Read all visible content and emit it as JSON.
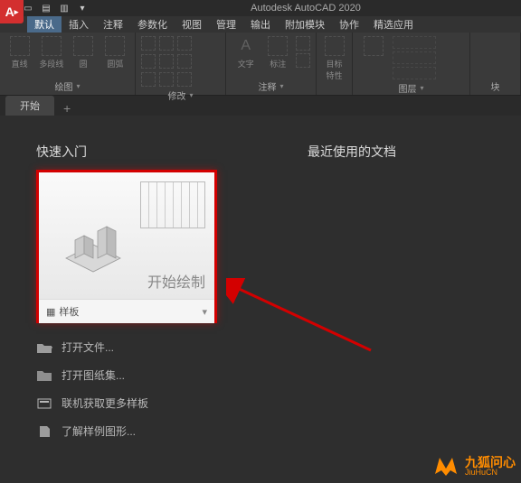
{
  "titlebar": {
    "app_title": "Autodesk AutoCAD 2020"
  },
  "logo": "A",
  "menus": {
    "items": [
      {
        "label": "默认",
        "active": true
      },
      {
        "label": "插入",
        "active": false
      },
      {
        "label": "注释",
        "active": false
      },
      {
        "label": "参数化",
        "active": false
      },
      {
        "label": "视图",
        "active": false
      },
      {
        "label": "管理",
        "active": false
      },
      {
        "label": "输出",
        "active": false
      },
      {
        "label": "附加模块",
        "active": false
      },
      {
        "label": "协作",
        "active": false
      },
      {
        "label": "精选应用",
        "active": false
      }
    ]
  },
  "ribbon": {
    "draw": {
      "label": "绘图",
      "btn1": "直线",
      "btn2": "多段线",
      "btn3": "圆",
      "btn4": "圆弧"
    },
    "modify": {
      "label": "修改"
    },
    "annotate": {
      "label": "注释",
      "btn1": "文字",
      "btn2": "标注"
    },
    "properties": {
      "label": "特性",
      "btn": "目标\n特性"
    },
    "layers": {
      "label": "图层"
    },
    "block": {
      "label": "块"
    }
  },
  "tabs": {
    "start": "开始",
    "plus": "+"
  },
  "start": {
    "quick_start": "快速入门",
    "recent_docs": "最近使用的文档",
    "card_caption": "开始绘制",
    "template_label": "样板",
    "links": {
      "open_file": "打开文件...",
      "open_sheetset": "打开图纸集...",
      "get_templates": "联机获取更多样板",
      "sample_drawings": "了解样例图形..."
    }
  },
  "watermark": {
    "cn": "九狐问心",
    "en": "JiuHuCN"
  }
}
